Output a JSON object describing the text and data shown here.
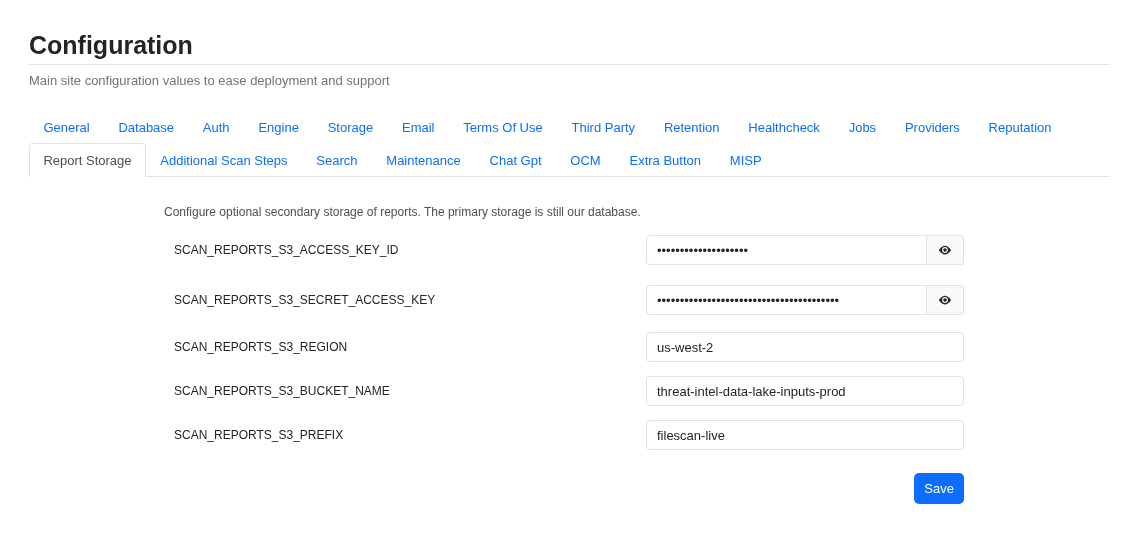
{
  "page": {
    "title": "Configuration",
    "subtitle": "Main site configuration values to ease deployment and support"
  },
  "tabs": [
    {
      "label": "General",
      "selected": false
    },
    {
      "label": "Database",
      "selected": false
    },
    {
      "label": "Auth",
      "selected": false
    },
    {
      "label": "Engine",
      "selected": false
    },
    {
      "label": "Storage",
      "selected": false
    },
    {
      "label": "Email",
      "selected": false
    },
    {
      "label": "Terms Of Use",
      "selected": false
    },
    {
      "label": "Third Party",
      "selected": false
    },
    {
      "label": "Retention",
      "selected": false
    },
    {
      "label": "Healthcheck",
      "selected": false
    },
    {
      "label": "Jobs",
      "selected": false
    },
    {
      "label": "Providers",
      "selected": false
    },
    {
      "label": "Reputation",
      "selected": false
    },
    {
      "label": "Report Storage",
      "selected": true
    },
    {
      "label": "Additional Scan Steps",
      "selected": false
    },
    {
      "label": "Search",
      "selected": false
    },
    {
      "label": "Maintenance",
      "selected": false
    },
    {
      "label": "Chat Gpt",
      "selected": false
    },
    {
      "label": "OCM",
      "selected": false
    },
    {
      "label": "Extra Button",
      "selected": false
    },
    {
      "label": "MISP",
      "selected": false
    }
  ],
  "form": {
    "description": "Configure optional secondary storage of reports. The primary storage is still our database.",
    "fields": [
      {
        "label": "SCAN_REPORTS_S3_ACCESS_KEY_ID",
        "kind": "secret",
        "value": "••••••••••••••••••••"
      },
      {
        "label": "SCAN_REPORTS_S3_SECRET_ACCESS_KEY",
        "kind": "secret",
        "value": "••••••••••••••••••••••••••••••••••••••••"
      },
      {
        "label": "SCAN_REPORTS_S3_REGION",
        "kind": "text",
        "value": "us-west-2"
      },
      {
        "label": "SCAN_REPORTS_S3_BUCKET_NAME",
        "kind": "text",
        "value": "threat-intel-data-lake-inputs-prod"
      },
      {
        "label": "SCAN_REPORTS_S3_PREFIX",
        "kind": "text",
        "value": "filescan-live"
      }
    ],
    "save_button": "Save"
  }
}
